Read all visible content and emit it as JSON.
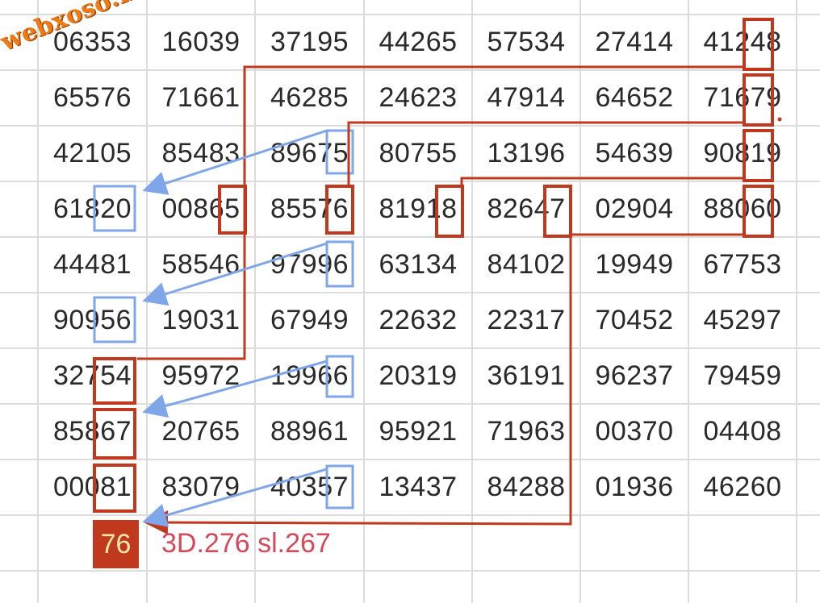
{
  "watermark": "webxoso.net",
  "rows": [
    [
      "06353",
      "16039",
      "37195",
      "44265",
      "57534",
      "27414",
      "41248"
    ],
    [
      "65576",
      "71661",
      "46285",
      "24623",
      "47914",
      "64652",
      "71679"
    ],
    [
      "42105",
      "85483",
      "89675",
      "80755",
      "13196",
      "54639",
      "90819"
    ],
    [
      "61820",
      "00865",
      "85576",
      "81918",
      "82647",
      "02904",
      "88060"
    ],
    [
      "44481",
      "58546",
      "97996",
      "63134",
      "84102",
      "19949",
      "67753"
    ],
    [
      "90956",
      "19031",
      "67949",
      "22632",
      "22317",
      "70452",
      "45297"
    ],
    [
      "32754",
      "95972",
      "19966",
      "20319",
      "36191",
      "96237",
      "79459"
    ],
    [
      "85867",
      "20765",
      "88961",
      "95921",
      "71963",
      "00370",
      "04408"
    ],
    [
      "00081",
      "83079",
      "40357",
      "13437",
      "84288",
      "01936",
      "46260"
    ]
  ],
  "result": {
    "number": "76",
    "note": "3D.276 sl.267"
  },
  "colors": {
    "red": "#c0381e",
    "blue": "#7fa6e8",
    "text": "#2a2a2a",
    "grid": "#dcdcdc",
    "result_box": "#c0381e",
    "result_text": "#ffe9a8",
    "note": "#d44a5a",
    "watermark": "#f07a14"
  }
}
